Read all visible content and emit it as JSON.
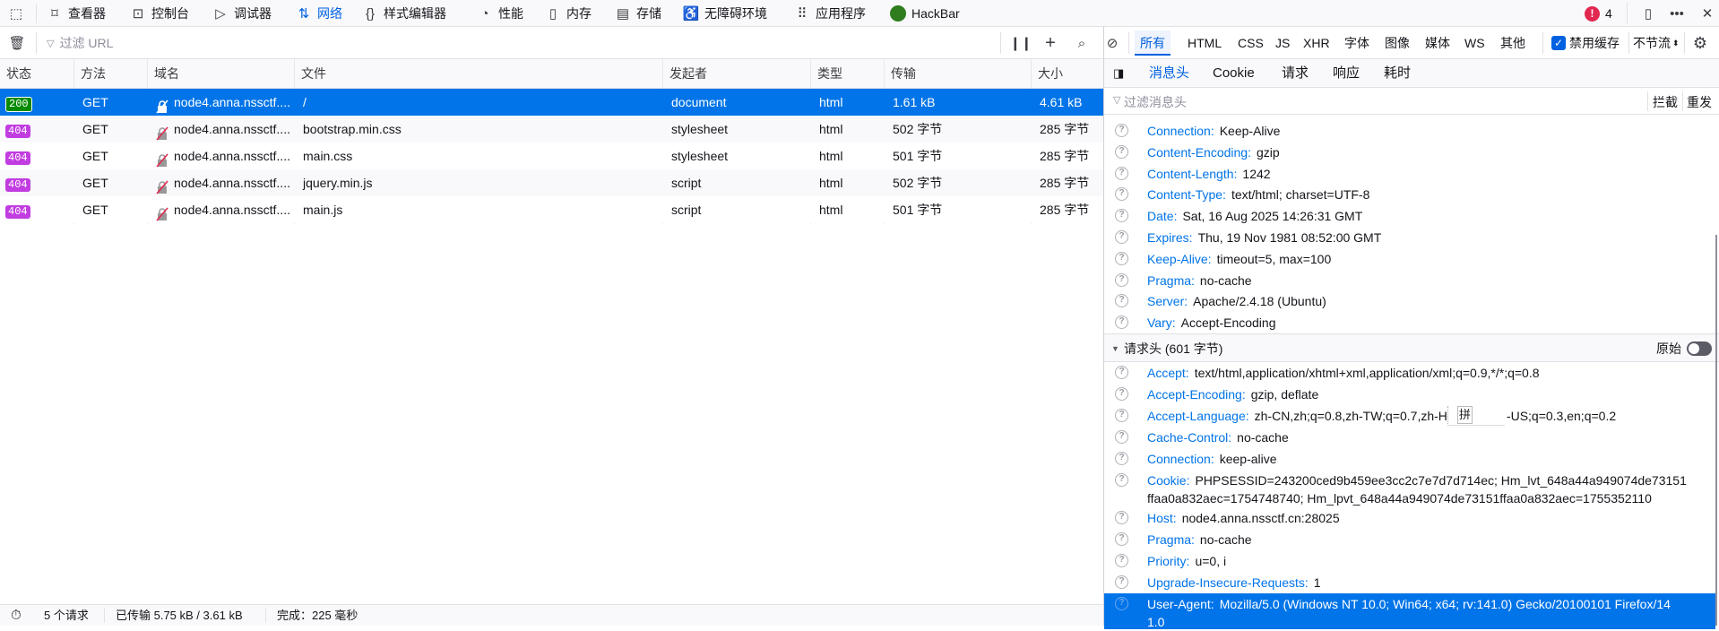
{
  "toolbar": {
    "tools": [
      "查看器",
      "控制台",
      "调试器",
      "网络",
      "样式编辑器",
      "性能",
      "内存",
      "存储",
      "无障碍环境",
      "应用程序",
      "HackBar"
    ],
    "error_count": "4"
  },
  "filterbar": {
    "url_placeholder": "过滤 URL",
    "type_tabs": [
      "所有",
      "HTML",
      "CSS",
      "JS",
      "XHR",
      "字体",
      "图像",
      "媒体",
      "WS",
      "其他"
    ],
    "disable_cache_label": "禁用缓存",
    "disable_cache_checked": true,
    "throttle": "不节流"
  },
  "table": {
    "headers": [
      "状态",
      "方法",
      "域名",
      "文件",
      "发起者",
      "类型",
      "传输",
      "大小"
    ],
    "rows": [
      {
        "status": "200",
        "method": "GET",
        "domain": "node4.anna.nssctf....",
        "file": "/",
        "initiator": "document",
        "type": "html",
        "transferred": "1.61 kB",
        "size": "4.61 kB"
      },
      {
        "status": "404",
        "method": "GET",
        "domain": "node4.anna.nssctf....",
        "file": "bootstrap.min.css",
        "initiator": "stylesheet",
        "type": "html",
        "transferred": "502 字节",
        "size": "285 字节"
      },
      {
        "status": "404",
        "method": "GET",
        "domain": "node4.anna.nssctf....",
        "file": "main.css",
        "initiator": "stylesheet",
        "type": "html",
        "transferred": "501 字节",
        "size": "285 字节"
      },
      {
        "status": "404",
        "method": "GET",
        "domain": "node4.anna.nssctf....",
        "file": "jquery.min.js",
        "initiator": "script",
        "type": "html",
        "transferred": "502 字节",
        "size": "285 字节"
      },
      {
        "status": "404",
        "method": "GET",
        "domain": "node4.anna.nssctf....",
        "file": "main.js",
        "initiator": "script",
        "type": "html",
        "transferred": "501 字节",
        "size": "285 字节"
      }
    ]
  },
  "statusbar": {
    "requests": "5 个请求",
    "transferred": "已传输 5.75 kB / 3.61 kB",
    "finish": "完成：225 毫秒"
  },
  "panel": {
    "tabs": [
      "消息头",
      "Cookie",
      "请求",
      "响应",
      "耗时"
    ],
    "filter_placeholder": "过滤消息头",
    "block_label": "拦截",
    "resend_label": "重发",
    "response_headers": [
      {
        "name": "Connection:",
        "value": "Keep-Alive"
      },
      {
        "name": "Content-Encoding:",
        "value": "gzip"
      },
      {
        "name": "Content-Length:",
        "value": "1242"
      },
      {
        "name": "Content-Type:",
        "value": "text/html; charset=UTF-8"
      },
      {
        "name": "Date:",
        "value": "Sat, 16 Aug 2025 14:26:31 GMT"
      },
      {
        "name": "Expires:",
        "value": "Thu, 19 Nov 1981 08:52:00 GMT"
      },
      {
        "name": "Keep-Alive:",
        "value": "timeout=5, max=100"
      },
      {
        "name": "Pragma:",
        "value": "no-cache"
      },
      {
        "name": "Server:",
        "value": "Apache/2.4.18 (Ubuntu)"
      },
      {
        "name": "Vary:",
        "value": "Accept-Encoding"
      }
    ],
    "request_section": {
      "title": "请求头 (601 字节)",
      "raw_label": "原始"
    },
    "request_headers": {
      "accept": {
        "name": "Accept:",
        "value": "text/html,application/xhtml+xml,application/xml;q=0.9,*/*;q=0.8"
      },
      "accept_encoding": {
        "name": "Accept-Encoding:",
        "value": "gzip, deflate"
      },
      "accept_language": {
        "name": "Accept-Language:",
        "value_start": "zh-CN,zh;q=0.8,zh-TW;q=0.7,zh-H",
        "value_end": "-US;q=0.3,en;q=0.2"
      },
      "cache_control": {
        "name": "Cache-Control:",
        "value": "no-cache"
      },
      "connection": {
        "name": "Connection:",
        "value": "keep-alive"
      },
      "cookie": {
        "name": "Cookie:",
        "value_line1": "PHPSESSID=243200ced9b459ee3cc2c7e7d7d714ec; Hm_lvt_648a44a949074de73151",
        "value_line2": "ffaa0a832aec=1754748740; Hm_lpvt_648a44a949074de73151ffaa0a832aec=1755352110"
      },
      "host": {
        "name": "Host:",
        "value": "node4.anna.nssctf.cn:28025"
      },
      "pragma": {
        "name": "Pragma:",
        "value": "no-cache"
      },
      "priority": {
        "name": "Priority:",
        "value": "u=0, i"
      },
      "upgrade": {
        "name": "Upgrade-Insecure-Requests:",
        "value": "1"
      },
      "user_agent": {
        "name": "User-Agent:",
        "value_line1": "Mozilla/5.0 (Windows NT 10.0; Win64; x64; rv:141.0) Gecko/20100101 Firefox/14",
        "value_line2": "1.0"
      }
    },
    "ime_glyph": "拼"
  },
  "colors": {
    "accent": "#0061e0",
    "selected_row": "#0074e8",
    "ok": "#058b00",
    "not_found": "#c13de0",
    "error": "#e22850"
  }
}
